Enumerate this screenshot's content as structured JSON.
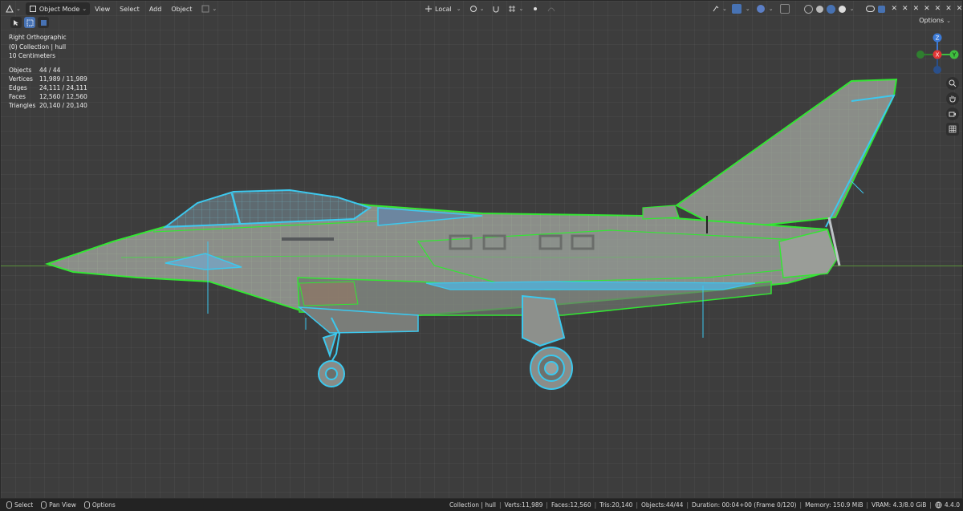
{
  "header": {
    "mode": "Object Mode",
    "menus": [
      "View",
      "Select",
      "Add",
      "Object"
    ],
    "transform_orientation": "Local",
    "options_label": "Options"
  },
  "overlay": {
    "view_name": "Right Orthographic",
    "collection": "(0) Collection | hull",
    "scale": "10 Centimeters"
  },
  "stats": [
    {
      "label": "Objects",
      "value": "44 / 44"
    },
    {
      "label": "Vertices",
      "value": "11,989 / 11,989"
    },
    {
      "label": "Edges",
      "value": "24,111 / 24,111"
    },
    {
      "label": "Faces",
      "value": "12,560 / 12,560"
    },
    {
      "label": "Triangles",
      "value": "20,140 / 20,140"
    }
  ],
  "gizmo": {
    "z": "Z",
    "y": "Y",
    "x": "X"
  },
  "statusbar": {
    "left": [
      {
        "label": "Select"
      },
      {
        "label": "Pan View"
      },
      {
        "label": "Options"
      }
    ],
    "right": [
      "Collection | hull",
      "Verts:11,989",
      "Faces:12,560",
      "Tris:20,140",
      "Objects:44/44",
      "Duration: 00:04+00 (Frame 0/120)",
      "Memory: 150.9 MiB",
      "VRAM: 4.3/8.0 GiB",
      "4.4.0"
    ]
  },
  "colors": {
    "background": "#3d3d3d",
    "wire_selected": "#33e633",
    "wire_active": "#3cc8ee",
    "accent": "#4772b3"
  }
}
